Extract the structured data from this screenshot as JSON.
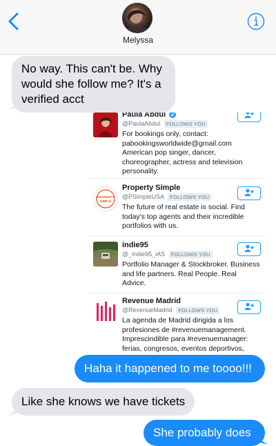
{
  "header": {
    "contact_name": "Melyssa"
  },
  "messages": [
    {
      "direction": "incoming",
      "text": "No way. This can't be. Why would she follow me? It's a verified acct"
    },
    {
      "direction": "outgoing",
      "text": "Haha it happened to me toooo!!!"
    },
    {
      "direction": "incoming",
      "text": "Like she knows we have tickets"
    },
    {
      "direction": "outgoing",
      "text": "She probably does"
    }
  ],
  "followers": [
    {
      "name": "Paula Abdul",
      "handle": "@PaulaAbdul",
      "badge": "FOLLOWS YOU",
      "verified": true,
      "bio": "For bookings only, contact: pabookingsworldwide@gmail.com American pop singer, dancer, choreographer, actress and television personality."
    },
    {
      "name": "Property Simple",
      "handle": "@PSimpleUSA",
      "badge": "FOLLOWS YOU",
      "verified": false,
      "bio": "The future of real estate is social. Find today's top agents and their incredible portfolios with us.",
      "logo_text": "PROPERTY SIMPLE"
    },
    {
      "name": "indie95",
      "handle": "@_indie95_iAS",
      "badge": "FOLLOWS YOU",
      "verified": false,
      "bio": "Portfolio Manager & Stockbroker. Business and life partners. Real People. Real Advice."
    },
    {
      "name": "Revenue Madrid",
      "handle": "@RevenueMadrid",
      "badge": "FOLLOWS YOU",
      "verified": false,
      "bio": "La agenda de Madrid dirigida a los profesiones de #revenuemanagement. Imprescindible para #revenuemanager: ferias, congresos, eventos deportivos,"
    }
  ],
  "colors": {
    "accent_blue": "#1a8bf8",
    "incoming_bubble": "#e5e5ea",
    "twitter_blue": "#1da1f2"
  },
  "icons": {
    "back": "chevron-left-icon",
    "info": "info-icon",
    "follow": "add-user-icon",
    "verified": "verified-badge-icon"
  }
}
